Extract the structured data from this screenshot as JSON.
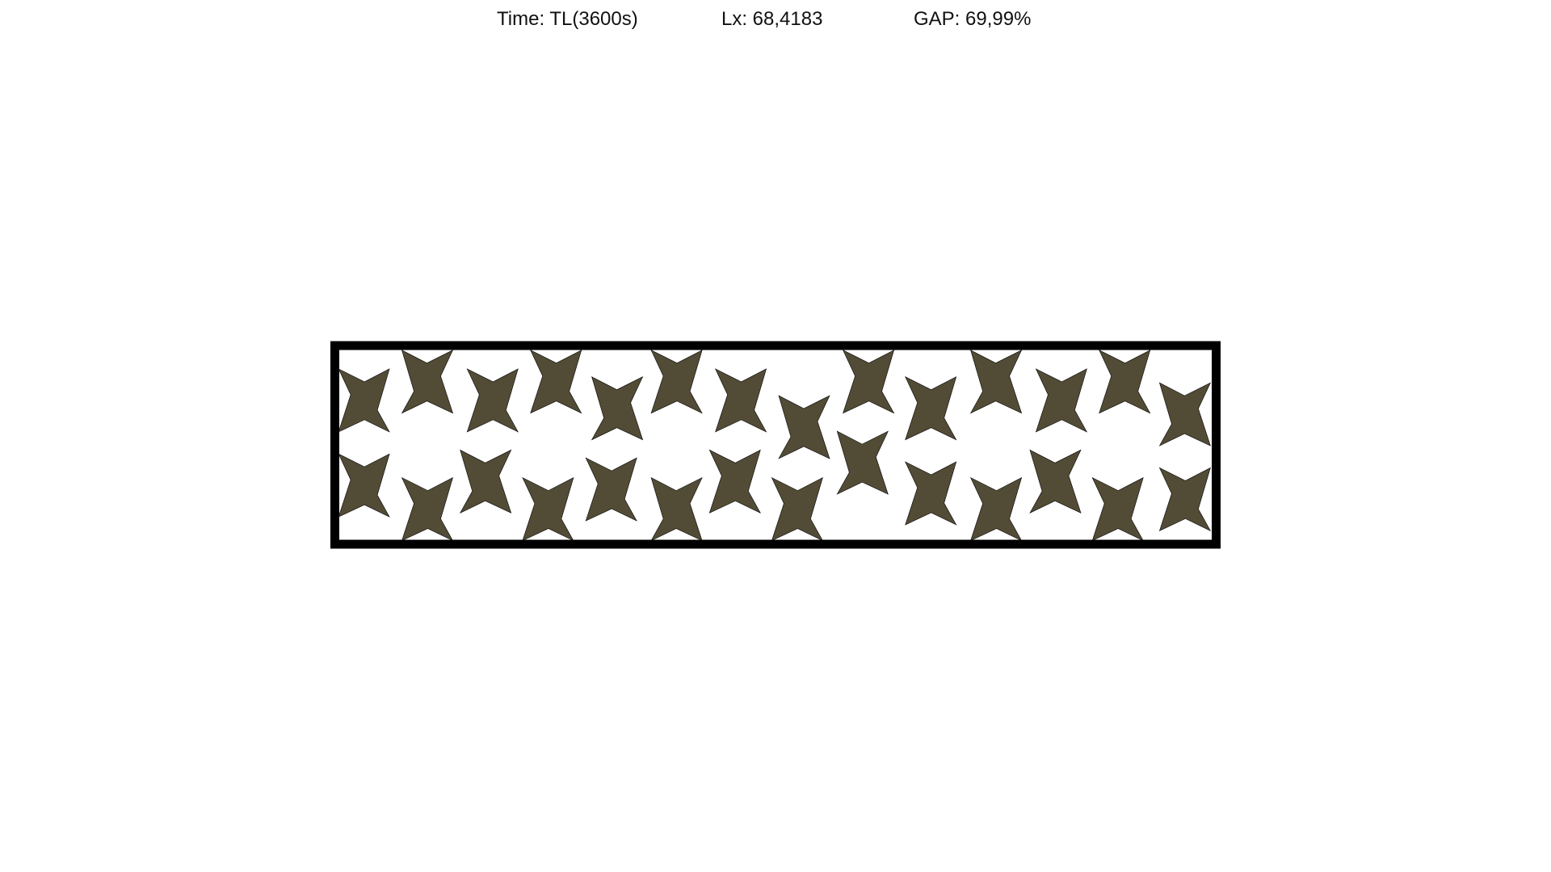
{
  "header": {
    "time": "Time: TL(3600s)",
    "lx": "Lx: 68,4183",
    "gap": "GAP: 69,99%"
  },
  "board": {
    "star_count": 28,
    "colors": {
      "star_fill": "#524b36",
      "star_edge": "#000000",
      "frame": "#000000",
      "background": "#ffffff"
    }
  }
}
